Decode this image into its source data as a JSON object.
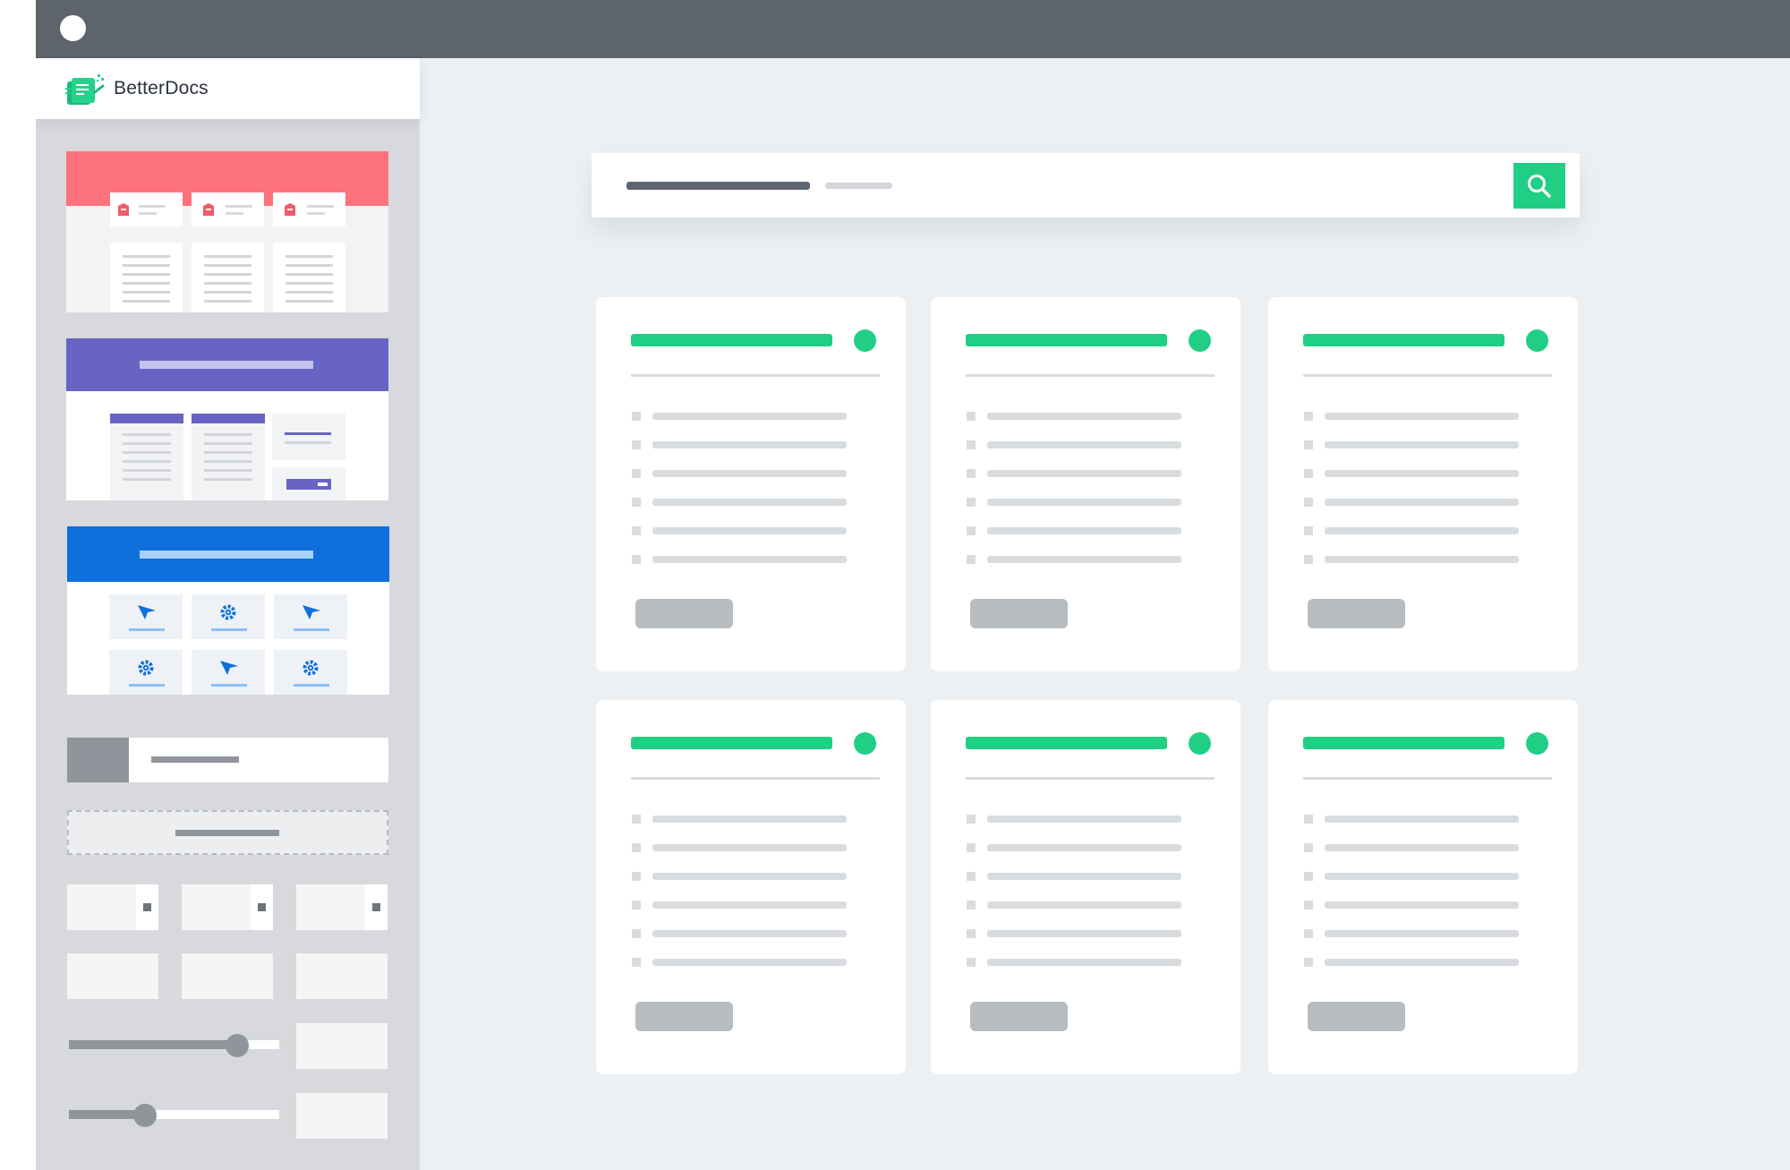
{
  "colors": {
    "accent": "#20cf83",
    "titlebar": "#5d646b",
    "template_red": "#fe727c",
    "template_purple": "#6864c4",
    "template_blue": "#0f6fdd"
  },
  "app": {
    "brand_name": "BetterDocs",
    "logo_icon": "betterdocs-logo-icon"
  },
  "search": {
    "icon": "search-icon"
  },
  "sidebar_controls": {
    "slider_1_value": 0.8,
    "slider_2_value": 0.36
  }
}
